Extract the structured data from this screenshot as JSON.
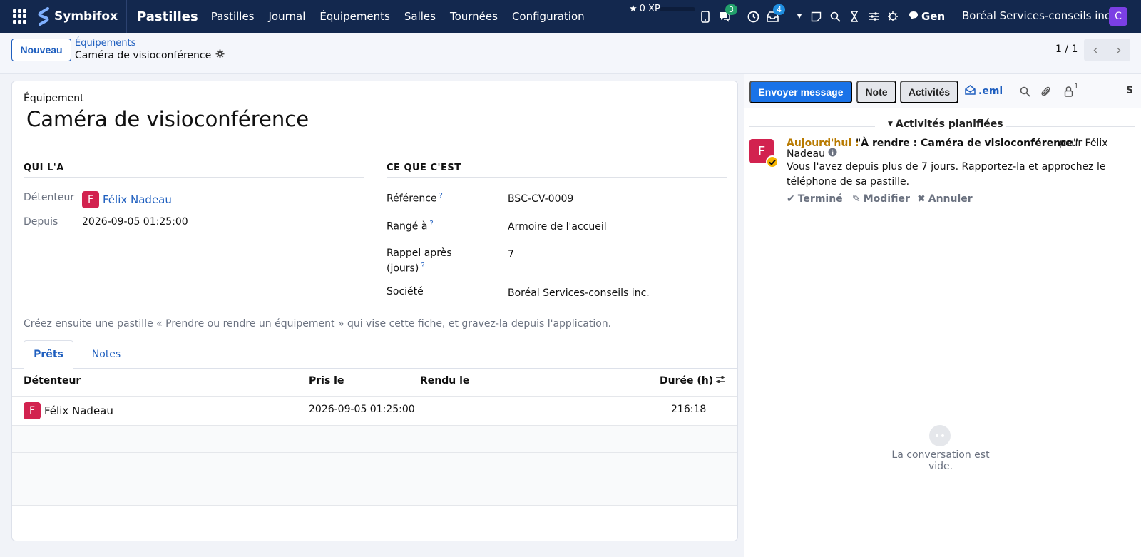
{
  "topbar": {
    "brand": "Symbifox",
    "app_name": "Pastilles",
    "menu": [
      "Pastilles",
      "Journal",
      "Équipements",
      "Salles",
      "Tournées",
      "Configuration"
    ],
    "xp": "0 XP",
    "messages_badge": "3",
    "activities_badge": "4",
    "gen_label": "Gen",
    "company": "Boréal Services-conseils inc.",
    "user_initial": "C"
  },
  "control": {
    "new_label": "Nouveau",
    "breadcrumb_parent": "Équipements",
    "breadcrumb_current": "Caméra de visioconférence",
    "pager": "1 / 1"
  },
  "form": {
    "model_label": "Équipement",
    "title": "Caméra de visioconférence",
    "group_who": "QUI L'A",
    "holder_label": "Détenteur",
    "holder_initial": "F",
    "holder_name": "Félix Nadeau",
    "since_label": "Depuis",
    "since_value": "2026-09-05 01:25:00",
    "group_what": "CE QUE C'EST",
    "reference_label": "Référence",
    "reference_value": "BSC-CV-0009",
    "stored_label": "Rangé à",
    "stored_value": "Armoire de l'accueil",
    "reminder_label_1": "Rappel après",
    "reminder_label_2": "(jours)",
    "reminder_value": "7",
    "company_label": "Société",
    "company_value": "Boréal Services-conseils inc.",
    "help_mark": "?",
    "hint": "Créez ensuite une pastille « Prendre ou rendre un équipement » qui vise cette fiche, et gravez-la depuis l'application."
  },
  "tabs": [
    "Prêts",
    "Notes"
  ],
  "loans_table": {
    "columns": [
      "Détenteur",
      "Pris le",
      "Rendu le",
      "Durée (h)"
    ],
    "rows": [
      {
        "initial": "F",
        "holder": "Félix Nadeau",
        "taken": "2026-09-05 01:25:00",
        "returned": "",
        "duration": "216:18"
      }
    ]
  },
  "chatter": {
    "send_label": "Envoyer message",
    "note_label": "Note",
    "activities_label": "Activités",
    "eml_label": ".eml",
    "followers_count": "1",
    "s_label": "S",
    "planned_title": "Activités planifiées",
    "activity": {
      "initial": "F",
      "when": "Aujourd'hui :",
      "summary": "\"À rendre : Caméra de visioconférence\"",
      "pour": "pour Félix",
      "name_rest": "Nadeau",
      "note": "Vous l'avez depuis plus de 7 jours. Rapportez-la et approchez le téléphone de sa pastille.",
      "done_label": "Terminé",
      "edit_label": "Modifier",
      "cancel_label": "Annuler"
    },
    "empty_text": "La conversation est vide."
  },
  "colors": {
    "navbar": "#13284e",
    "primary": "#1a73e8",
    "link": "#1f5fbf",
    "avatar_f": "#d2224f",
    "avatar_c": "#7b3fe4",
    "today": "#b87a00"
  }
}
